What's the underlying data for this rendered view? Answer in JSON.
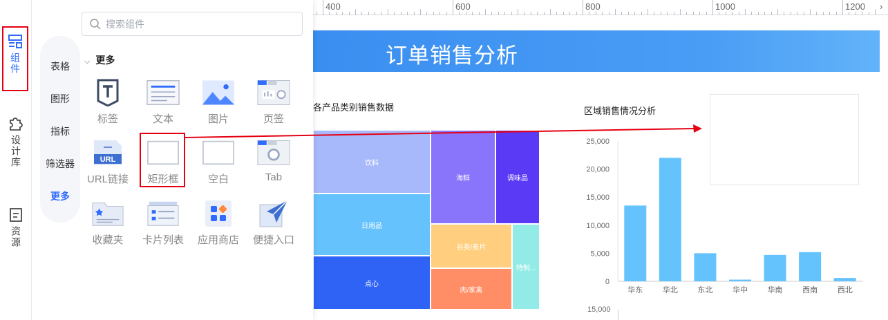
{
  "rail": {
    "items": [
      {
        "label": "组件",
        "icon": "component-icon"
      },
      {
        "label": "设计库",
        "icon": "puzzle-icon"
      },
      {
        "label": "资源",
        "icon": "resource-icon"
      }
    ]
  },
  "panel": {
    "search_placeholder": "搜索组件",
    "categories": [
      "表格",
      "图形",
      "指标",
      "筛选器",
      "更多"
    ],
    "active_category": "更多",
    "section_title": "更多",
    "components": [
      {
        "label": "标签",
        "icon": "text-tag-icon"
      },
      {
        "label": "文本",
        "icon": "text-block-icon"
      },
      {
        "label": "图片",
        "icon": "image-icon"
      },
      {
        "label": "页签",
        "icon": "tab-page-icon"
      },
      {
        "label": "URL链接",
        "icon": "url-link-icon"
      },
      {
        "label": "矩形框",
        "icon": "rectangle-icon"
      },
      {
        "label": "空白",
        "icon": "blank-icon"
      },
      {
        "label": "Tab",
        "icon": "tab-icon"
      },
      {
        "label": "收藏夹",
        "icon": "favorites-folder-icon"
      },
      {
        "label": "卡片列表",
        "icon": "card-list-icon"
      },
      {
        "label": "应用商店",
        "icon": "app-store-icon"
      },
      {
        "label": "便捷入口",
        "icon": "quick-entry-icon"
      }
    ]
  },
  "ruler": {
    "labels": [
      "400",
      "600",
      "800",
      "1000",
      "1200"
    ]
  },
  "dashboard": {
    "title": "订单销售分析",
    "colors": {
      "banner": "#3a8ef0",
      "bar": "#64c3fd",
      "highlight": "#e60012"
    }
  },
  "chart_data": [
    {
      "type": "treemap",
      "title": "各产品类别销售数据",
      "items": [
        {
          "label": "饮料",
          "color": "#a7b8fb"
        },
        {
          "label": "日用品",
          "color": "#65c2fc"
        },
        {
          "label": "点心",
          "color": "#2f63f6"
        },
        {
          "label": "海鲜",
          "color": "#8875fb"
        },
        {
          "label": "调味品",
          "color": "#5a3af5"
        },
        {
          "label": "谷类/麦片",
          "color": "#ffcf7f"
        },
        {
          "label": "肉/家禽",
          "color": "#ff8d66"
        },
        {
          "label": "特制...",
          "color": "#93ebe7"
        }
      ]
    },
    {
      "type": "bar",
      "title": "区域销售情况分析",
      "categories": [
        "华东",
        "华北",
        "东北",
        "华中",
        "华南",
        "西南",
        "西北"
      ],
      "values": [
        13500,
        22000,
        5000,
        300,
        4700,
        5200,
        600
      ],
      "ylim": [
        0,
        25000
      ],
      "yticks": [
        "25,000",
        "20,000",
        "15,000",
        "10,000",
        "5,000",
        "0"
      ],
      "color": "#64c3fd"
    }
  ],
  "lower_chart": {
    "ytick": "15,000"
  }
}
